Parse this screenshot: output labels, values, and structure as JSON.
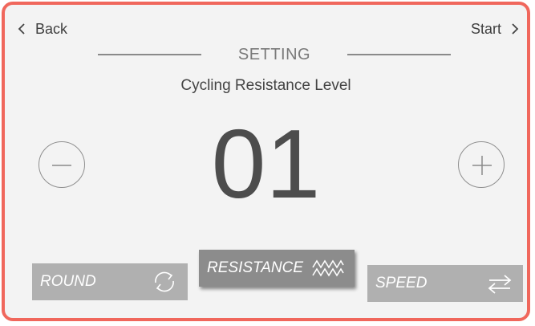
{
  "nav": {
    "back_label": "Back",
    "start_label": "Start"
  },
  "header": {
    "section_title": "SETTING",
    "subtitle": "Cycling Resistance Level"
  },
  "level": {
    "value": "01"
  },
  "controls": {
    "decrease_icon": "minus-circle-icon",
    "increase_icon": "plus-circle-icon"
  },
  "modes": [
    {
      "label": "ROUND",
      "icon": "cycle-arrows-icon",
      "selected": false
    },
    {
      "label": "RESISTANCE",
      "icon": "zigzag-wave-icon",
      "selected": true
    },
    {
      "label": "SPEED",
      "icon": "swap-arrows-icon",
      "selected": false
    }
  ],
  "colors": {
    "frame_border": "#f0675c",
    "background": "#f3f3f3",
    "tab": "#b0b0b0",
    "tab_selected": "#8c8c8c",
    "text_dark": "#4d4d4d"
  }
}
